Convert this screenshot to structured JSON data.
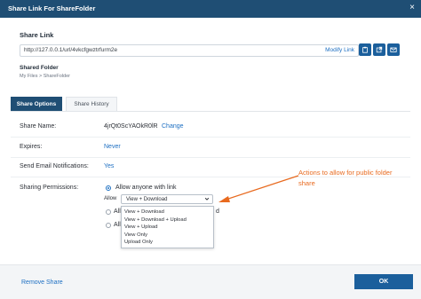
{
  "dialog": {
    "title": "Share Link For ShareFolder",
    "close_glyph": "×"
  },
  "share_link": {
    "label": "Share Link",
    "url": "http://127.0.0.1/url/4vkcfgwztrfurm2e",
    "modify_label": "Modify Link",
    "buttons": [
      {
        "icon": "clipboard-icon"
      },
      {
        "icon": "external-link-icon"
      },
      {
        "icon": "email-icon"
      }
    ]
  },
  "shared_folder": {
    "label": "Shared Folder",
    "path": "My Files > ShareFolder"
  },
  "tabs": [
    {
      "label": "Share Options",
      "active": true
    },
    {
      "label": "Share History",
      "active": false
    }
  ],
  "options": {
    "share_name": {
      "label": "Share Name:",
      "value": "4jrQt0ScYAOkR0lR",
      "action": "Change"
    },
    "expires": {
      "label": "Expires:",
      "value": "Never"
    },
    "email_notifications": {
      "label": "Send Email Notifications:",
      "value": "Yes"
    },
    "permissions": {
      "label": "Sharing Permissions:",
      "radio_1_label": "Allow anyone with link",
      "radio_2_partial": "All",
      "radio_2_trailing": "d",
      "radio_3_partial": "All",
      "allow_label": "Allow",
      "selected": "View + Download",
      "dropdown_options": [
        "View + Download",
        "View + Download + Upload",
        "View + Upload",
        "View Only",
        "Upload Only"
      ]
    }
  },
  "annotation": {
    "text": "Actions to allow for public folder share",
    "color": "#e86a1f"
  },
  "footer": {
    "remove_label": "Remove Share",
    "ok_label": "OK"
  },
  "colors": {
    "header": "#1f4e74",
    "primary_button": "#1b5f9c",
    "link": "#1d6fc2"
  }
}
